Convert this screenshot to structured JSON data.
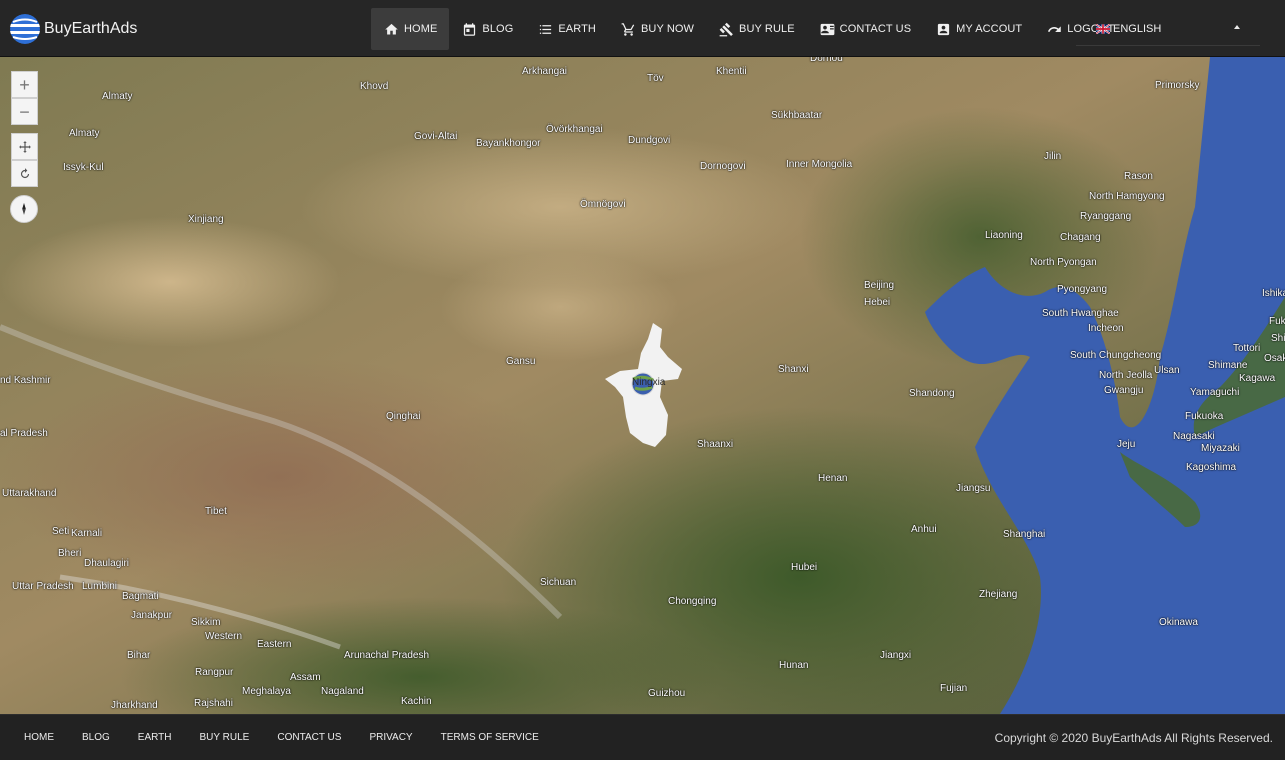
{
  "brand": {
    "name": "BuyEarthAds"
  },
  "nav": {
    "items": [
      {
        "label": "HOME",
        "icon": "home-icon"
      },
      {
        "label": "BLOG",
        "icon": "calendar-icon"
      },
      {
        "label": "EARTH",
        "icon": "list-icon"
      },
      {
        "label": "BUY NOW",
        "icon": "cart-icon"
      },
      {
        "label": "BUY RULE",
        "icon": "gavel-icon"
      },
      {
        "label": "CONTACT US",
        "icon": "contact-card-icon"
      },
      {
        "label": "MY ACCOUT",
        "icon": "account-box-icon"
      },
      {
        "label": "LOGOUT",
        "icon": "redo-arrow-icon"
      }
    ],
    "active_index": 0
  },
  "language": {
    "selected": "ENGLISH",
    "flag": "uk-flag-icon"
  },
  "map": {
    "controls": {
      "zoom_in": "+",
      "zoom_out": "−"
    },
    "selected_province": "Ningxia",
    "labels": {
      "arkhangai": "Arkhangai",
      "tov": "Töv",
      "khentii": "Khentii",
      "dornod": "Dornod",
      "primorsky": "Primorsky",
      "almaty1": "Almaty",
      "khovd": "Khovd",
      "sukhbaatar": "Sükhbaatar",
      "almaty2": "Almaty",
      "govi_altai": "Govi-Altai",
      "ovorkhangai": "Övörkhangai",
      "bayankhongor": "Bayankhongor",
      "dundgovi": "Dundgovi",
      "issyk_kul": "Issyk-Kul",
      "jilin": "Jilin",
      "dornogovi": "Dornogovi",
      "inner_mongolia": "Inner Mongolia",
      "rason": "Rason",
      "north_hamgyong": "North Hamgyong",
      "omnogovi": "Ömnögovi",
      "ryanggang": "Ryanggang",
      "xinjiang": "Xinjiang",
      "liaoning": "Liaoning",
      "chagang": "Chagang",
      "north_pyongan": "North Pyongan",
      "beijing": "Beijing",
      "hebei": "Hebei",
      "pyongyang": "Pyongyang",
      "ishikawa": "Ishika",
      "south_hwanghae": "South Hwanghae",
      "fukui": "Fuku",
      "incheon": "Incheon",
      "shiga": "Shi",
      "tottori": "Tottori",
      "gansu": "Gansu",
      "south_chungcheong": "South Chungcheong",
      "osaka": "Osak",
      "shimane": "Shimane",
      "shanxi": "Shanxi",
      "ulsan": "Ulsan",
      "north_jeolla": "North Jeolla",
      "kagawa": "Kagawa",
      "kashmir": "nd Kashmir",
      "gwangju": "Gwangju",
      "yamaguchi": "Yamaguchi",
      "shandong": "Shandong",
      "qinghai": "Qinghai",
      "fukuoka": "Fukuoka",
      "pradesh": "al Pradesh",
      "nagasaki": "Nagasaki",
      "shaanxi": "Shaanxi",
      "jeju": "Jeju",
      "miyazaki": "Miyazaki",
      "kagoshima": "Kagoshima",
      "henan": "Henan",
      "uttarakhand": "Uttarakhand",
      "jiangsu": "Jiangsu",
      "tibet": "Tibet",
      "seti": "Seti",
      "karnali": "Karnali",
      "anhui": "Anhui",
      "shanghai": "Shanghai",
      "bheri": "Bheri",
      "dhaulagiri": "Dhaulagiri",
      "hubei": "Hubei",
      "uttar_pradesh": "Uttar Pradesh",
      "lumbini": "Lumbini",
      "sichuan": "Sichuan",
      "bagmati": "Bagmati",
      "zhejiang": "Zhejiang",
      "chongqing": "Chongqing",
      "janakpur": "Janakpur",
      "sikkim": "Sikkim",
      "okinawa": "Okinawa",
      "western": "Western",
      "eastern": "Eastern",
      "arunachal": "Arunachal Pradesh",
      "jiangxi": "Jiangxi",
      "bihar": "Bihar",
      "hunan": "Hunan",
      "rangpur": "Rangpur",
      "assam": "Assam",
      "fujian": "Fujian",
      "meghalaya": "Meghalaya",
      "nagaland": "Nagaland",
      "guizhou": "Guizhou",
      "rajshahi": "Rajshahi",
      "kachin": "Kachin",
      "jharkhand": "Jharkhand"
    }
  },
  "footer": {
    "links": [
      "HOME",
      "BLOG",
      "EARTH",
      "BUY RULE",
      "CONTACT US",
      "PRIVACY",
      "TERMS OF SERVICE"
    ],
    "copyright": "Copyright © 2020 BuyEarthAds All Rights Reserved."
  },
  "colors": {
    "header_bg": "#262626",
    "footer_bg": "#222222",
    "ocean": "#3a5fb0",
    "land": "#8f8a5c",
    "province": "#f2f2f2"
  }
}
